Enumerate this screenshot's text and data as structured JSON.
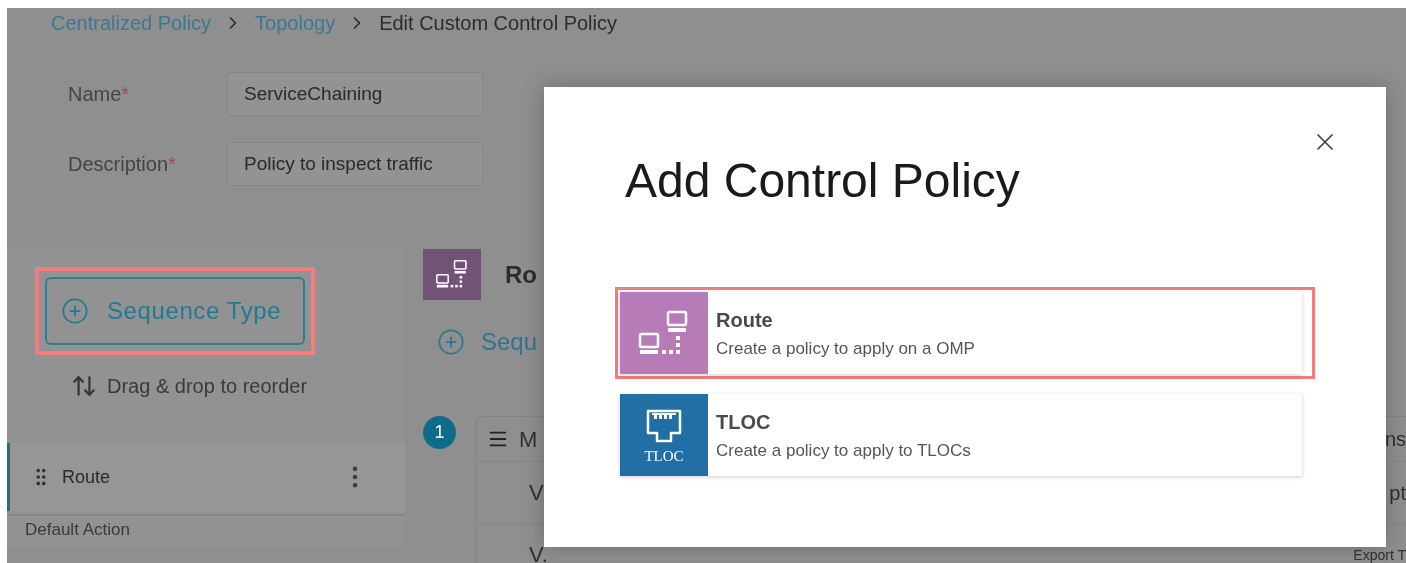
{
  "breadcrumb": [
    {
      "label": "Centralized Policy",
      "kind": "link"
    },
    {
      "label": "Topology",
      "kind": "link"
    },
    {
      "label": "Edit Custom Control Policy",
      "kind": "current"
    }
  ],
  "form": [
    {
      "label": "Name",
      "required_mark": "*",
      "value": "ServiceChaining"
    },
    {
      "label": "Description",
      "required_mark": "*",
      "value": "Policy to inspect traffic"
    }
  ],
  "sequence_panel": {
    "add_button": "Sequence Type",
    "add_button_highlighted": true,
    "hint": "Drag & drop to reorder",
    "items": [
      {
        "label": "Route",
        "selected": true
      }
    ],
    "default_action": "Default Action"
  },
  "sequence_detail": {
    "title": "Ro",
    "add_button": "Sequ",
    "number": "1",
    "rows": [
      {
        "kind": "header",
        "left": "M",
        "right": "ns"
      },
      {
        "kind": "field",
        "left": "V",
        "right": "pt"
      },
      {
        "kind": "field",
        "left": "V.",
        "right": "Export T"
      }
    ]
  },
  "modal": {
    "title": "Add Control Policy",
    "options": [
      {
        "kind": "route",
        "title": "Route",
        "description": "Create a policy to apply on a OMP",
        "selected": true
      },
      {
        "kind": "tloc",
        "title": "TLOC",
        "icon_label": "TLOC",
        "description": "Create a policy to apply to TLOCs",
        "selected": false
      }
    ]
  }
}
